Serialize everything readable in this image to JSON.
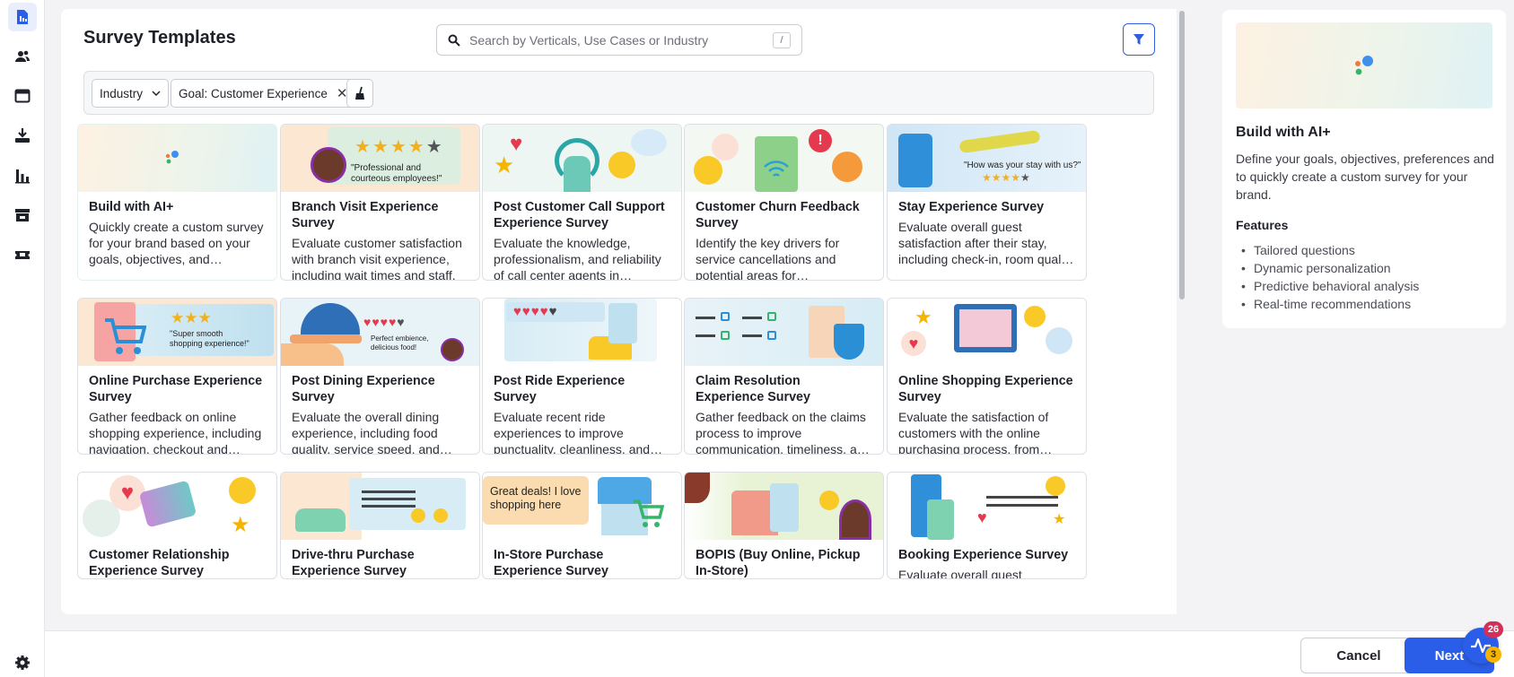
{
  "rail": {
    "items": [
      {
        "icon": "survey-doc-icon",
        "active": true
      },
      {
        "icon": "people-icon"
      },
      {
        "icon": "browser-window-icon"
      },
      {
        "icon": "download-tray-icon"
      },
      {
        "icon": "bar-chart-icon"
      },
      {
        "icon": "store-icon"
      },
      {
        "icon": "ticket-icon"
      }
    ],
    "bottom_icon": "settings-icon"
  },
  "header": {
    "title": "Survey Templates",
    "search_placeholder": "Search by Verticals, Use Cases or Industry",
    "search_shortcut": "/"
  },
  "filters": {
    "industry_label": "Industry",
    "goal_label": "Goal: Customer Experience"
  },
  "cards": [
    {
      "title": "Build with AI+",
      "desc": "Quickly create a custom survey for your brand based on your goals, objectives, and preferences."
    },
    {
      "title": "Branch Visit Experience Survey",
      "desc": "Evaluate customer satisfaction with branch visit experience, including wait times and staff.",
      "quote": "\"Professional and courteous employees!\""
    },
    {
      "title": "Post Customer Call Support Experience Survey",
      "desc": "Evaluate the knowledge, professionalism, and reliability of call center agents in resolving issues."
    },
    {
      "title": "Customer Churn Feedback Survey",
      "desc": "Identify the key drivers for service cancellations and potential areas for improvement."
    },
    {
      "title": "Stay Experience Survey",
      "desc": "Evaluate overall guest satisfaction after their stay, including check-in, room quality and more.",
      "quote": "\"How was your stay with us?\""
    },
    {
      "title": "Online Purchase Experience Survey",
      "desc": "Gather feedback on online shopping experience, including navigation, checkout and delivery.",
      "quote": "\"Super smooth shopping experience!\""
    },
    {
      "title": "Post Dining Experience Survey",
      "desc": "Evaluate the overall dining experience, including food quality, service speed, and ambience.",
      "quote": "Perfect embience, delicious food!"
    },
    {
      "title": "Post Ride Experience Survey",
      "desc": "Evaluate recent ride experiences to improve punctuality, cleanliness, and safety."
    },
    {
      "title": "Claim Resolution Experience Survey",
      "desc": "Gather feedback on the claims process to improve communication, timeliness, and outcomes."
    },
    {
      "title": "Online Shopping Experience Survey",
      "desc": "Evaluate the satisfaction of customers with the online purchasing process, from browsing to delivery."
    },
    {
      "title": "Customer Relationship Experience Survey",
      "desc": ""
    },
    {
      "title": "Drive-thru Purchase Experience Survey",
      "desc": ""
    },
    {
      "title": "In-Store Purchase Experience Survey",
      "desc": "",
      "quote": "Great deals! I love shopping here"
    },
    {
      "title": "BOPIS (Buy Online, Pickup In-Store)",
      "desc": ""
    },
    {
      "title": "Booking Experience Survey",
      "desc": "Evaluate overall guest"
    }
  ],
  "side_panel": {
    "title": "Build with AI+",
    "description": "Define your goals, objectives, preferences and to quickly create a custom survey for your brand.",
    "features_heading": "Features",
    "features": [
      "Tailored questions",
      "Dynamic personalization",
      "Predictive behavioral analysis",
      "Real-time recommendations"
    ]
  },
  "footer": {
    "cancel_label": "Cancel",
    "next_label": "Next",
    "notif_count": "26",
    "alert_count": "3"
  },
  "colors": {
    "primary": "#2b5ee8",
    "badge_red": "#d22f5a",
    "badge_yellow": "#f5b400"
  }
}
